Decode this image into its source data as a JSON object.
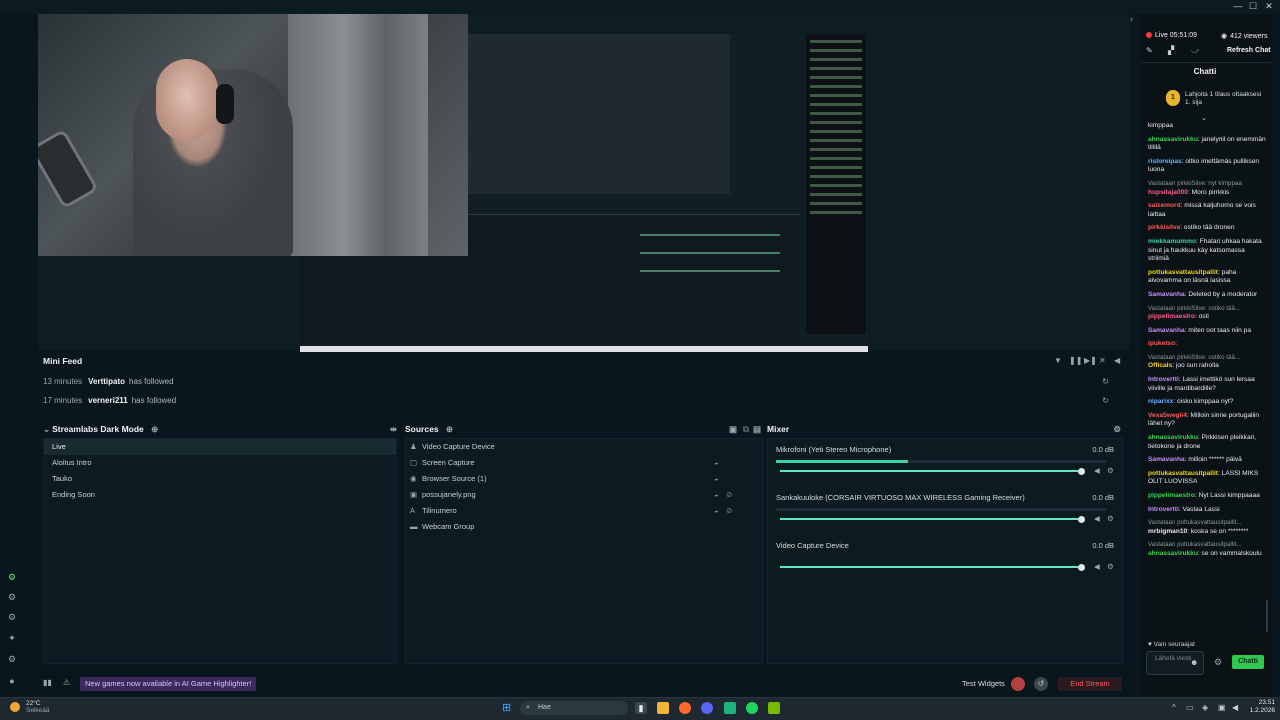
{
  "window": {
    "minimize": "—",
    "maximize": "☐",
    "close": "✕",
    "collapse_arrow": "›"
  },
  "preview": {
    "webcam_alt": "",
    "nested_label": ""
  },
  "minifeed": {
    "title": "Mini Feed",
    "events": [
      {
        "time": "13 minutes",
        "user": "Verttipato",
        "action": "has followed"
      },
      {
        "time": "17 minutes",
        "user": "verneri211",
        "action": "has followed"
      }
    ]
  },
  "scenes": {
    "title": "Streamlabs Dark Mode",
    "items": [
      "Live",
      "Aloitus Intro",
      "Tauko",
      "Ending Soon"
    ],
    "active": "Live"
  },
  "sources": {
    "title": "Sources",
    "items": [
      {
        "icon": "speaker-icon",
        "label": "Video Capture Device"
      },
      {
        "icon": "screen-icon",
        "label": "Screen Capture"
      },
      {
        "icon": "globe-icon",
        "label": "Browser Source (1)"
      },
      {
        "icon": "image-icon",
        "label": "possujanely.png"
      },
      {
        "icon": "text-icon",
        "label": "Tilinumero"
      },
      {
        "icon": "folder-icon",
        "label": "Webcam Group"
      }
    ]
  },
  "mixer": {
    "title": "Mixer",
    "channels": [
      {
        "name": "Mikrofoni (Yeti Stereo Microphone)",
        "db": "0.0 dB",
        "level": 0.4
      },
      {
        "name": "Sankakuuloke (CORSAIR VIRTUOSO MAX WIRELESS Gaming Receiver)",
        "db": "0.0 dB",
        "level": 0.0
      },
      {
        "name": "Video Capture Device",
        "db": "0.0 dB",
        "level": 0.0
      }
    ]
  },
  "bottombar": {
    "banner": "New games now available in AI Game Highlighter!",
    "test_widgets": "Test Widgets",
    "end_stream": "End Stream"
  },
  "chat": {
    "live": "Live 05:51:09",
    "viewers": "412 viewers",
    "refresh": "Refresh Chat",
    "title": "Chatti",
    "gift_badge": "1",
    "gift_text": "Lahjoita 1 tilaus ottaaksesi 1. sija",
    "messages": [
      {
        "reply": "",
        "user": "",
        "color": "#e6ebee",
        "text": "kimppaa"
      },
      {
        "reply": "",
        "user": "ahnassavirukku",
        "color": "#39d353",
        "text": ": janelynil on enemmän tilillä"
      },
      {
        "reply": "",
        "user": "ristoreipas",
        "color": "#5fb3ff",
        "text": ": oltko imettämäs pulliksen luona"
      },
      {
        "reply": "Vastataan pirkkiSilve: nyt kimppaa",
        "user": "hupsitaja000",
        "color": "#ff5a8a",
        "text": ": Moro pirrkkis"
      },
      {
        "reply": "",
        "user": "saizemord",
        "color": "#ff5a5a",
        "text": ": missä kaljuhomo se vois laittaa"
      },
      {
        "reply": "",
        "user": "pirkkisilve",
        "color": "#ff5a5a",
        "text": ": ostiko tää dronen"
      },
      {
        "reply": "",
        "user": "miekkamummo",
        "color": "#39d3a3",
        "text": ": Fhatari uhkaa hakata sinut ja haukkuu käy katsomassa striimiä"
      },
      {
        "reply": "",
        "user": "pottukasvattausitpallit",
        "color": "#f2d21a",
        "text": ": paha aivovamma on läsnä lasissa"
      },
      {
        "reply": "",
        "user": "Samavanha",
        "color": "#c58cff",
        "text": ": Deleted by a moderator"
      },
      {
        "reply": "Vastataan pirkkiSilve: ostiko tää...",
        "user": "pippelimaestro",
        "color": "#ff5a8a",
        "text": ": osti"
      },
      {
        "reply": "",
        "user": "Samavanha",
        "color": "#c58cff",
        "text": ": miten oot taas niin pa"
      },
      {
        "reply": "",
        "user": "ipuketso",
        "color": "#ff5a5a",
        "text": ":"
      },
      {
        "reply": "Vastataan pirkkiSilve: ostiko tää...",
        "user": "Officals",
        "color": "#f2d21a",
        "text": ": joo sun raholla"
      },
      {
        "reply": "",
        "user": "Introvertti",
        "color": "#c58cff",
        "text": ": Lassi imettikö sun lersaa viiville ja mardibardille?"
      },
      {
        "reply": "",
        "user": "niparixx",
        "color": "#5fb3ff",
        "text": ": oisko kimppaa nyt?"
      },
      {
        "reply": "",
        "user": "Vexa5wegii4",
        "color": "#ff5a5a",
        "text": ": Milloin sinne portugaliin lähet ny?"
      },
      {
        "reply": "",
        "user": "ahnassavirukku",
        "color": "#39d353",
        "text": ": Pirkkisen pleikkari, tietokone ja drone"
      },
      {
        "reply": "",
        "user": "Samavanha",
        "color": "#c58cff",
        "text": ": milloin ****** päivä"
      },
      {
        "reply": "",
        "user": "pottukasvattausitpallit",
        "color": "#f2d21a",
        "text": ": LASSI MIKS OLIT LUOVISSA"
      },
      {
        "reply": "",
        "user": "pippelimaestro",
        "color": "#39d353",
        "text": ": Nyt Lassi kimppaaaa"
      },
      {
        "reply": "",
        "user": "Introvertti",
        "color": "#c58cff",
        "text": ": Vastaa Lassi"
      },
      {
        "reply": "Vastataan pottukasvattausitpallit...",
        "user": "mrbigman10",
        "color": "#e6ebee",
        "text": ": koska se on ********"
      },
      {
        "reply": "Vastataan pottukasvattausitpallit...",
        "user": "ahnassavirukku",
        "color": "#39d353",
        "text": ": se on vammalskoulu"
      }
    ],
    "follower_only": "Vain seuraajat",
    "input_placeholder": "Lähetä viesti",
    "send": "Chatti"
  },
  "taskbar": {
    "temp": "22°C",
    "weather": "Selkeää",
    "search": "Hae",
    "time": "23.51",
    "date": "1.2.2026"
  }
}
